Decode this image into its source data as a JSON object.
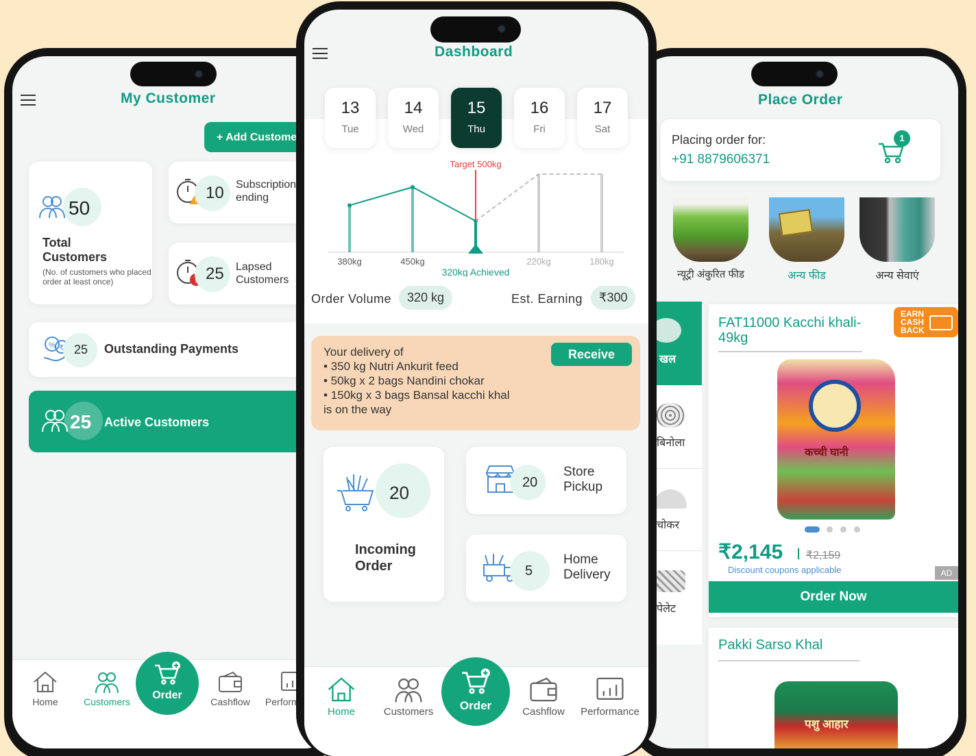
{
  "left": {
    "title": "My Customer",
    "add_button": "+ Add Customer",
    "total": {
      "count": "50",
      "label": "Total Customers",
      "note": "(No. of customers who placed order at least once)"
    },
    "subscription": {
      "count": "10",
      "label": "Subscription ending"
    },
    "lapsed": {
      "count": "25",
      "label": "Lapsed Customers"
    },
    "outstanding": {
      "count": "25",
      "label": "Outstanding Payments"
    },
    "active": {
      "count": "25",
      "label": "Active Customers"
    },
    "nav": {
      "home": "Home",
      "customers": "Customers",
      "order": "Order",
      "cashflow": "Cashflow",
      "performance": "Performance"
    }
  },
  "center": {
    "title": "Dashboard",
    "dates": [
      {
        "day": "13",
        "weekday": "Tue"
      },
      {
        "day": "14",
        "weekday": "Wed"
      },
      {
        "day": "15",
        "weekday": "Thu"
      },
      {
        "day": "16",
        "weekday": "Fri"
      },
      {
        "day": "17",
        "weekday": "Sat"
      }
    ],
    "chart_data": {
      "type": "line",
      "categories": [
        "13",
        "14",
        "15",
        "16",
        "17"
      ],
      "values": [
        380,
        450,
        320,
        500,
        500
      ],
      "labels": [
        "380kg",
        "450kg",
        "320kg Achieved",
        "220kg",
        "180kg"
      ],
      "target": 500,
      "target_label": "Target 500kg",
      "achieved_label": "320kg Achieved"
    },
    "order_volume_label": "Order Volume",
    "order_volume": "320 kg",
    "est_earning_label": "Est. Earning",
    "est_earning": "₹300",
    "delivery": {
      "line1": "Your delivery of",
      "items": [
        "• 350 kg Nutri Ankurit feed",
        "• 50kg x 2 bags Nandini chokar",
        "• 150kg x 3 bags Bansal kacchi khal"
      ],
      "line_end": "is on the way",
      "receive": "Receive"
    },
    "incoming": {
      "count": "20",
      "label": "Incoming Order"
    },
    "store": {
      "count": "20",
      "label": "Store Pickup"
    },
    "home_delivery": {
      "count": "5",
      "label": "Home Delivery"
    },
    "nav": {
      "home": "Home",
      "customers": "Customers",
      "order": "Order",
      "cashflow": "Cashflow",
      "performance": "Performance"
    }
  },
  "right": {
    "title": "Place Order",
    "placing_label": "Placing order for:",
    "phone": "+91 8879606371",
    "cart_count": "1",
    "top_categories": [
      "न्यूट्री अंकुरित फीड",
      "अन्य फीड",
      "अन्य सेवाएं"
    ],
    "side_categories": [
      "खल",
      "बिनोला",
      "चोकर",
      "पेलेट"
    ],
    "product": {
      "name": "FAT11000 Kacchi khali-49kg",
      "badge": "EARN CASH BACK",
      "price": "₹2,145",
      "old_price": "₹2,159",
      "discount": "Discount coupons applicable",
      "ad": "AD",
      "order_now": "Order Now",
      "bag_text": "कच्ची घानी"
    },
    "product2": {
      "name": "Pakki Sarso Khal",
      "bag_text": "पशु आहार"
    }
  }
}
